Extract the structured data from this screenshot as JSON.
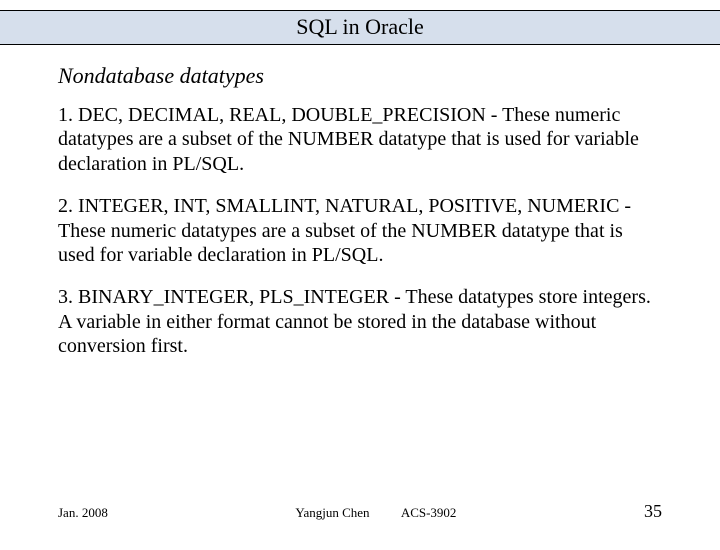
{
  "title": "SQL in Oracle",
  "heading": "Nondatabase datatypes",
  "paragraphs": [
    "1. DEC, DECIMAL, REAL, DOUBLE_PRECISION - These numeric datatypes are a subset of the NUMBER datatype that is used for variable declaration in PL/SQL.",
    "2. INTEGER, INT, SMALLINT, NATURAL, POSITIVE, NUMERIC - These numeric datatypes are a subset of the NUMBER datatype that is used for variable declaration in PL/SQL.",
    "3. BINARY_INTEGER, PLS_INTEGER - These datatypes store integers. A variable in either format cannot be stored in the database without conversion first."
  ],
  "footer": {
    "date": "Jan. 2008",
    "author": "Yangjun Chen",
    "course": "ACS-3902",
    "page": "35"
  }
}
